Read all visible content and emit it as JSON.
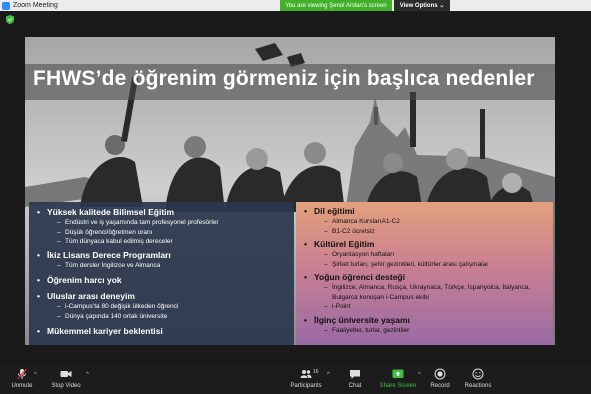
{
  "window": {
    "app_title": "Zoom Meeting"
  },
  "share_banner": {
    "viewing_text": "You are viewing Şenol Arslan's screen",
    "view_options": "View Options"
  },
  "slide": {
    "title": "FHWS’de öğrenim görmeniz için başlıca nedenler",
    "left": {
      "h1": "Yüksek kalitede Bilimsel Eğitim",
      "h1_items": [
        "Endüstri ve iş yaşamında tam profesyonel profesörler",
        "Düşük öğrenci/öğretmen oranı",
        "Tüm dünyaca kabul edilmiş dereceler"
      ],
      "h2": "İkiz Lisans Derece Programları",
      "h2_items": [
        "Tüm dersler İngilizce ve Almanca"
      ],
      "h3": "Öğrenim harcı yok",
      "h4": "Uluslar arası deneyim",
      "h4_items": [
        "i-Campus’ta 80 değişik ülkeden öğrenci",
        "Dünya çapında 140 ortak üniversite"
      ],
      "h5": "Mükemmel kariyer beklentisi"
    },
    "right": {
      "h1": "Dil eğitimi",
      "h1_items": [
        "Almanca KurslarıA1-C2",
        "B1-C2 ücretsiz"
      ],
      "h2": "Kültürel Eğitim",
      "h2_items": [
        "Oryantasyon haftaları",
        "Şirket turları, şehir gezintileri, kültürler arası çalışmalar"
      ],
      "h3": "Yoğun öğrenci desteği",
      "h3_items": [
        "İngilizce, Almanca, Rusça, Ukraynaca, Türkçe, İspanyolca, İtalyanca, Bulgarca konuşan i-Campus ekibi",
        "i-Point"
      ],
      "h4": "İlginç üniversite yaşamı",
      "h4_items": [
        "Faaliyetler, turlar, gezintiler"
      ]
    }
  },
  "controls": {
    "unmute": "Unmute",
    "stop_video": "Stop Video",
    "participants": "Participants",
    "participants_count": "16",
    "chat": "Chat",
    "share_screen": "Share Screen",
    "record": "Record",
    "reactions": "Reactions"
  },
  "colors": {
    "share_green": "#43b02a",
    "left_panel": "#2b374e",
    "right_panel_top": "#e3a07c",
    "right_panel_bottom": "#9a6aa5"
  }
}
